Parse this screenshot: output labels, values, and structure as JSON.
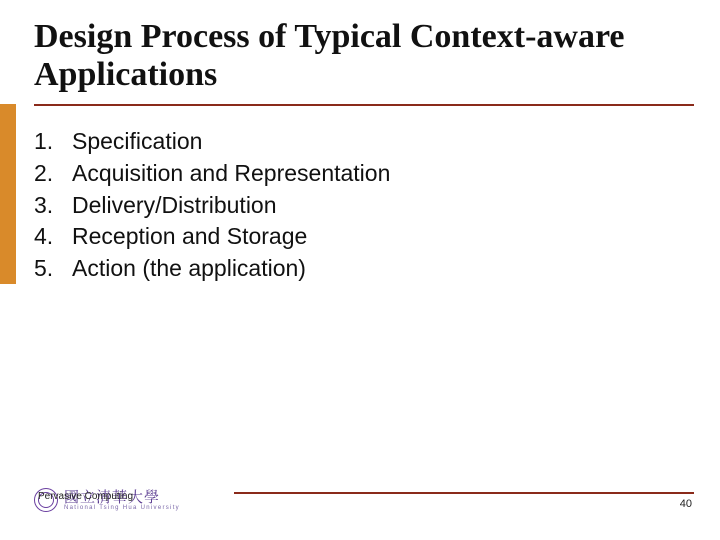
{
  "title": "Design Process of Typical Context-aware Applications",
  "items": [
    "Specification",
    "Acquisition and Representation",
    "Delivery/Distribution",
    "Reception and Storage",
    "Action (the application)"
  ],
  "footer": {
    "course": "Pervasive Computing",
    "logo_cn": "國立清華大學",
    "logo_en": "National Tsing Hua University",
    "page": "40"
  }
}
